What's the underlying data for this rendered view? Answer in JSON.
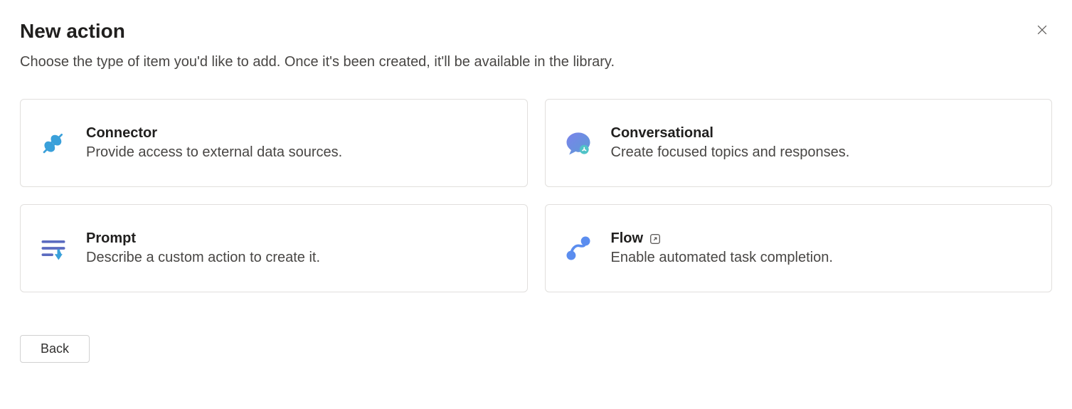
{
  "header": {
    "title": "New action",
    "subtitle": "Choose the type of item you'd like to add. Once it's been created, it'll be available in the library."
  },
  "cards": {
    "connector": {
      "title": "Connector",
      "description": "Provide access to external data sources."
    },
    "conversational": {
      "title": "Conversational",
      "description": "Create focused topics and responses."
    },
    "prompt": {
      "title": "Prompt",
      "description": "Describe a custom action to create it."
    },
    "flow": {
      "title": "Flow",
      "description": "Enable automated task completion."
    }
  },
  "footer": {
    "back_label": "Back"
  }
}
